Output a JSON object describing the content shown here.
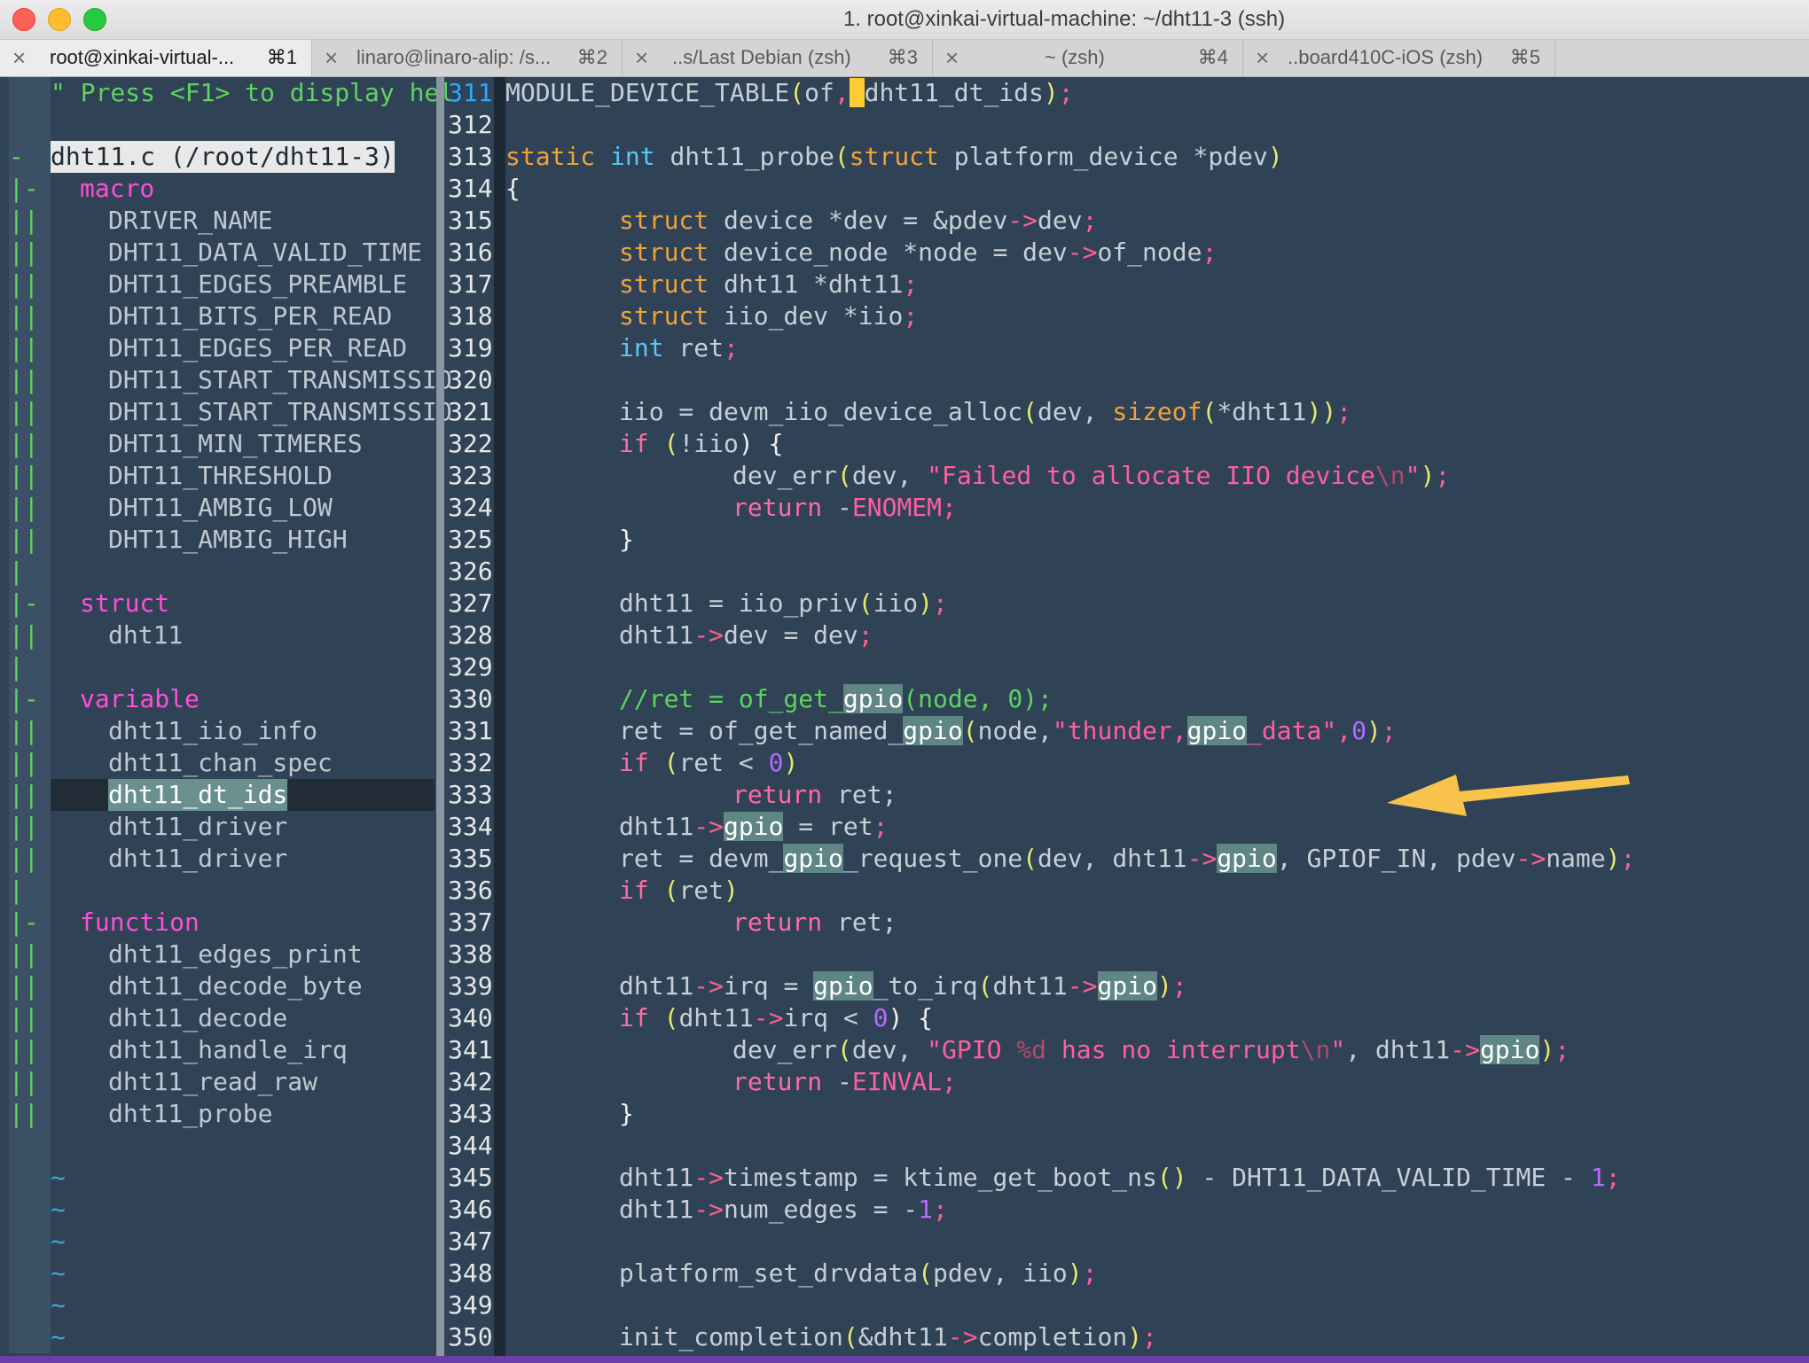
{
  "window": {
    "title": "1. root@xinkai-virtual-machine: ~/dht11-3 (ssh)"
  },
  "tabs": [
    {
      "label": "root@xinkai-virtual-...",
      "shortcut": "⌘1",
      "active": true
    },
    {
      "label": "linaro@linaro-alip: /s...",
      "shortcut": "⌘2",
      "active": false
    },
    {
      "label": "..s/Last Debian (zsh)",
      "shortcut": "⌘3",
      "active": false
    },
    {
      "label": "~ (zsh)",
      "shortcut": "⌘4",
      "active": false
    },
    {
      "label": "..board410C-iOS (zsh)",
      "shortcut": "⌘5",
      "active": false
    }
  ],
  "icons": {
    "close": "close-icon",
    "arrow": "annotation-arrow-icon"
  },
  "tagbar": {
    "help_line": "\" Press <F1> to display hel",
    "file_header": "dht11.c (/root/dht11-3)",
    "sections": [
      {
        "name": "macro",
        "items": [
          "DRIVER_NAME",
          "DHT11_DATA_VALID_TIME",
          "DHT11_EDGES_PREAMBLE",
          "DHT11_BITS_PER_READ",
          "DHT11_EDGES_PER_READ",
          "DHT11_START_TRANSMISSIO",
          "DHT11_START_TRANSMISSIO",
          "DHT11_MIN_TIMERES",
          "DHT11_THRESHOLD",
          "DHT11_AMBIG_LOW",
          "DHT11_AMBIG_HIGH"
        ]
      },
      {
        "name": "struct",
        "items": [
          "dht11"
        ]
      },
      {
        "name": "variable",
        "items": [
          "dht11_iio_info",
          "dht11_chan_spec",
          "dht11_dt_ids",
          "dht11_driver",
          "dht11_driver"
        ]
      },
      {
        "name": "function",
        "items": [
          "dht11_edges_print",
          "dht11_decode_byte",
          "dht11_decode",
          "dht11_handle_irq",
          "dht11_read_raw",
          "dht11_probe"
        ]
      }
    ],
    "selected_item": "dht11_dt_ids",
    "tilde": "~"
  },
  "editor": {
    "current_line": "311",
    "line_numbers": [
      "311",
      "312",
      "313",
      "314",
      "315",
      "316",
      "317",
      "318",
      "319",
      "320",
      "321",
      "322",
      "323",
      "324",
      "325",
      "326",
      "327",
      "328",
      "329",
      "330",
      "331",
      "332",
      "333",
      "334",
      "335",
      "336",
      "337",
      "338",
      "339",
      "340",
      "341",
      "342",
      "343",
      "344",
      "345",
      "346",
      "347",
      "348",
      "349",
      "350"
    ],
    "code": {
      "l311": [
        "MODULE_DEVICE_TABLE",
        "(",
        "of",
        ",",
        " ",
        "dht11_dt_ids",
        ")",
        ";"
      ],
      "l313": [
        "static",
        " ",
        "int",
        " dht11_probe",
        "(",
        "struct",
        " platform_device *pdev",
        ")"
      ],
      "l314": [
        "{"
      ],
      "l315": [
        "struct",
        " device *dev = &pdev",
        "->",
        "dev",
        ";"
      ],
      "l316": [
        "struct",
        " device_node *node = dev",
        "->",
        "of_node",
        ";"
      ],
      "l317": [
        "struct",
        " dht11 *dht11",
        ";"
      ],
      "l318": [
        "struct",
        " iio_dev *iio",
        ";"
      ],
      "l319": [
        "int",
        " ret",
        ";"
      ],
      "l321": [
        "iio = devm_iio_device_alloc",
        "(",
        "dev, ",
        "sizeof",
        "(",
        "*dht11",
        "))",
        ";"
      ],
      "l322": [
        "if",
        " (",
        "!iio",
        ") {"
      ],
      "l323": [
        "dev_err",
        "(",
        "dev, ",
        "\"Failed to allocate IIO device",
        "\\n",
        "\"",
        ")",
        ";"
      ],
      "l324": [
        "return",
        " -",
        "ENOMEM",
        ";"
      ],
      "l325": [
        "}"
      ],
      "l327": [
        "dht11 = iio_priv",
        "(",
        "iio",
        ")",
        ";"
      ],
      "l328": [
        "dht11",
        "->",
        "dev = dev",
        ";"
      ],
      "l330": [
        "//ret = of_get_",
        "gpio",
        "(node, 0);"
      ],
      "l331": [
        "ret = of_get_named_",
        "gpio",
        "(",
        "node,",
        "\"thunder,",
        "gpio",
        "_data\"",
        ",",
        "0",
        ")",
        ";"
      ],
      "l332": [
        "if",
        " (",
        "ret < ",
        "0",
        ")"
      ],
      "l333": [
        "return",
        " ret;"
      ],
      "l334": [
        "dht11",
        "->",
        "gpio",
        " = ret",
        ";"
      ],
      "l335": [
        "ret = devm_",
        "gpio",
        "_request_one",
        "(",
        "dev, dht11",
        "->",
        "gpio",
        ", GPIOF_IN, pdev",
        "->",
        "name",
        ")",
        ";"
      ],
      "l336": [
        "if",
        " (",
        "ret",
        ")"
      ],
      "l337": [
        "return",
        " ret;"
      ],
      "l339": [
        "dht11",
        "->",
        "irq = ",
        "gpio",
        "_to_irq",
        "(",
        "dht11",
        "->",
        "gpio",
        ")",
        ";"
      ],
      "l340": [
        "if",
        " (",
        "dht11",
        "->",
        "irq < ",
        "0",
        ") {"
      ],
      "l341": [
        "dev_err",
        "(",
        "dev, ",
        "\"GPIO ",
        "%d",
        " has no interrupt",
        "\\n",
        "\"",
        ", dht11",
        "->",
        "gpio",
        ")",
        ";"
      ],
      "l342": [
        "return",
        " -",
        "EINVAL",
        ";"
      ],
      "l343": [
        "}"
      ],
      "l345": [
        "dht11",
        "->",
        "timestamp = ktime_get_boot_ns",
        "()",
        " - DHT11_DATA_VALID_TIME - ",
        "1",
        ";"
      ],
      "l346": [
        "dht11",
        "->",
        "num_edges = -",
        "1",
        ";"
      ],
      "l348": [
        "platform_set_drvdata",
        "(",
        "pdev, iio",
        ")",
        ";"
      ],
      "l350": [
        "init_completion",
        "(",
        "&dht11",
        "->",
        "completion",
        ")",
        ";"
      ]
    }
  },
  "colors": {
    "background": "#2f4256",
    "keyword": "#f2a13b",
    "type": "#58c8f8",
    "string": "#ff5f9f",
    "comment": "#5fd35f",
    "number": "#b36bff",
    "arrow": "#f7c34a"
  }
}
